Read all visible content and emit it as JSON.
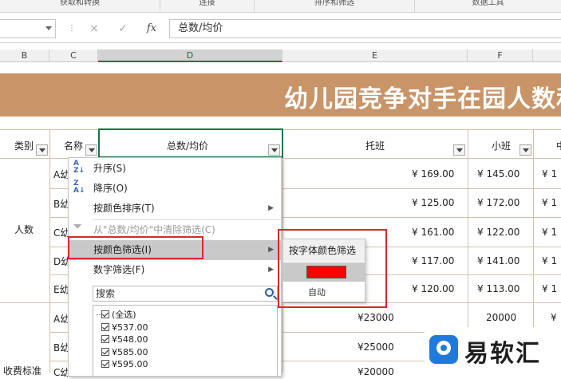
{
  "ribbon": {
    "groups": [
      "获取和转换",
      "连接",
      "排序和筛选",
      "数据工具"
    ]
  },
  "formula_bar": {
    "cancel_icon": "×",
    "enter_icon": "✓",
    "fx_label": "fx",
    "value": "总数/均价"
  },
  "columns": [
    "B",
    "C",
    "D",
    "E",
    "F"
  ],
  "banner": {
    "title": "幼儿园竞争对手在园人数和"
  },
  "table": {
    "headers": {
      "leibie": "类别",
      "mingcheng": "名称",
      "zongshu": "总数/均价",
      "tuoban": "托班",
      "xiaoban": "小班",
      "zhong": "中"
    },
    "group_labels": {
      "renshu": "人数",
      "shoufei": "收费标准"
    },
    "name_cells": [
      "A幼",
      "B幼",
      "C幼",
      "D幼",
      "E幼",
      "A幼",
      "B幼",
      "C幼"
    ],
    "tuoban_values": [
      "¥ 169.00",
      "¥ 125.00",
      "¥ 161.00",
      "¥ 117.00",
      "¥ 120.00",
      "¥23000",
      "¥25000",
      "¥20000"
    ],
    "xiaoban_values": [
      "¥ 145.00",
      "¥ 172.00",
      "¥ 122.00",
      "¥ 141.00",
      "¥ 113.00",
      "20000",
      "",
      ""
    ],
    "zhong_values": [
      "¥ 1",
      "¥ 1",
      "¥ 1",
      "¥ 1",
      "¥ 1",
      "¥",
      "",
      ""
    ]
  },
  "filter_menu": {
    "sort_asc": "升序(S)",
    "sort_desc": "降序(O)",
    "sort_by_color": "按颜色排序(T)",
    "clear_filter": "从\"总数/均价\"中清除筛选(C)",
    "filter_by_color": "按颜色筛选(I)",
    "number_filter": "数字筛选(F)",
    "search_placeholder": "搜索",
    "list_items": [
      "(全选)",
      "¥537.00",
      "¥548.00",
      "¥585.00",
      "¥595.00"
    ]
  },
  "color_submenu": {
    "heading": "按字体颜色筛选",
    "swatch_color": "#ff0000",
    "auto_label": "自动"
  },
  "watermark": {
    "text": "易软汇"
  },
  "colors": {
    "banner": "#c99467",
    "accent_green": "#217346",
    "annotation_red": "#d42a2a"
  }
}
